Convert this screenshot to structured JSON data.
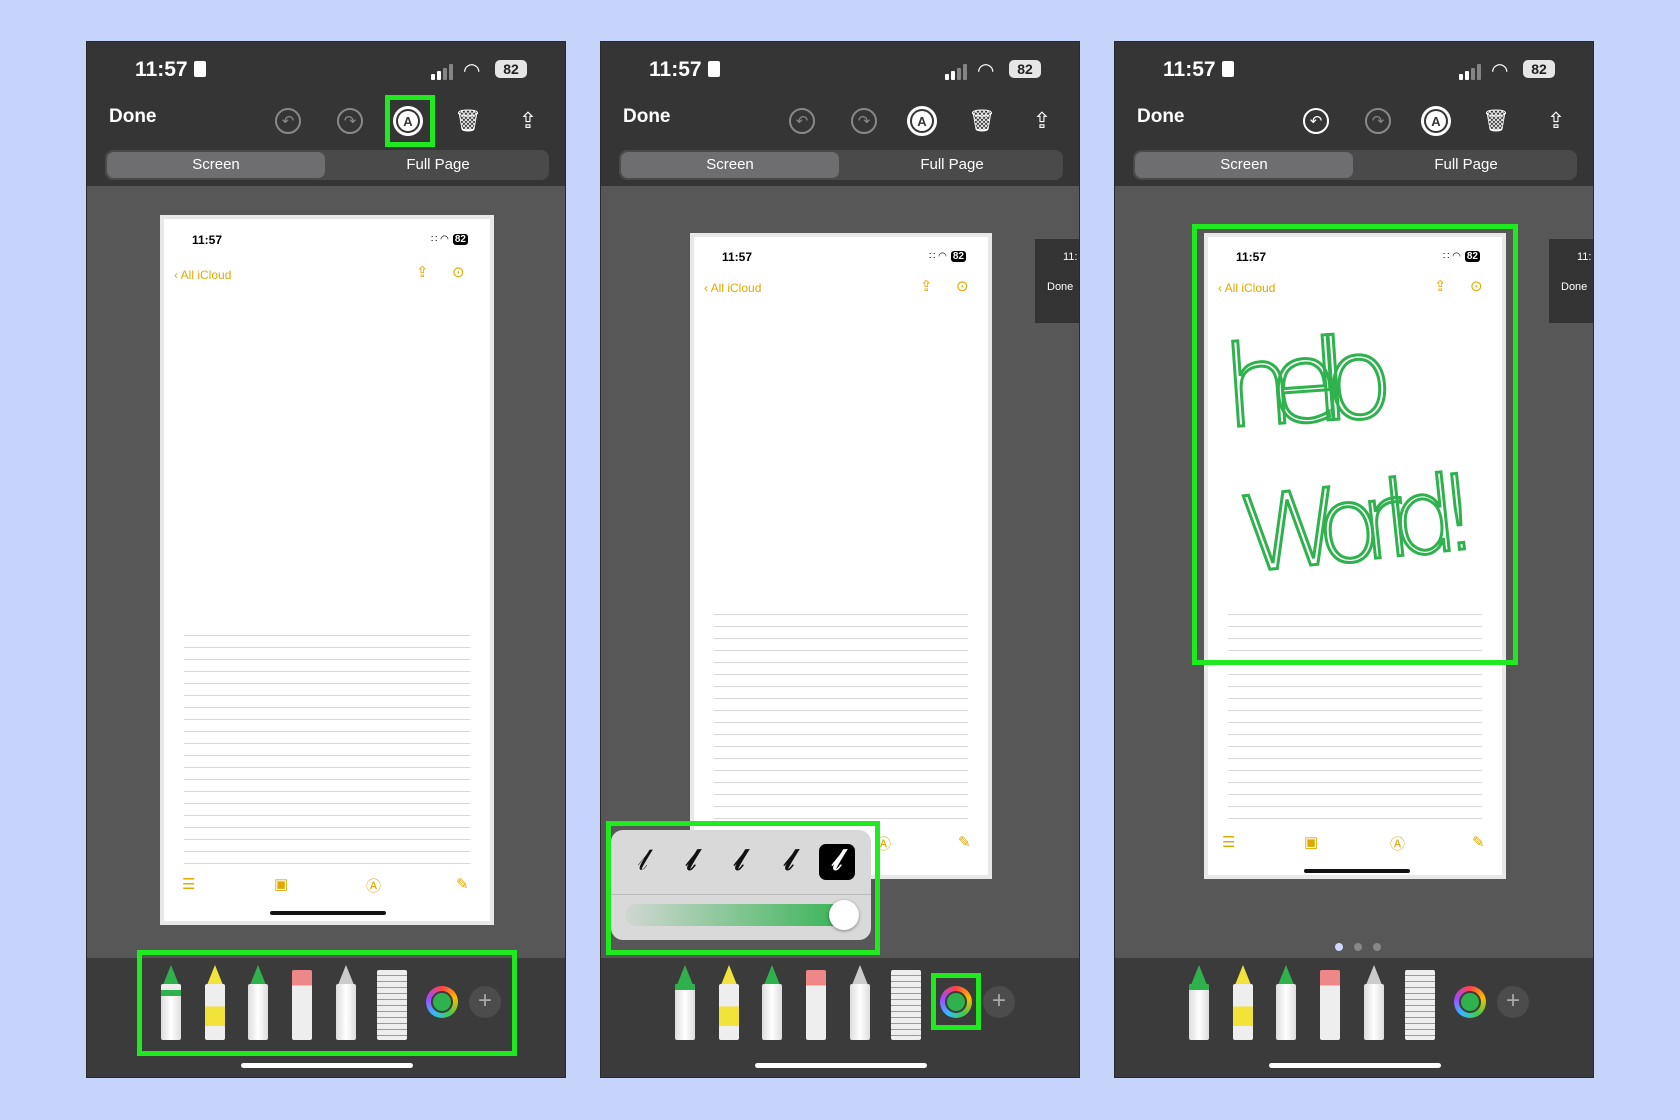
{
  "status": {
    "time": "11:57",
    "battery": "82"
  },
  "toolbar": {
    "done_label": "Done"
  },
  "tabs": {
    "screen": "Screen",
    "full_page": "Full Page"
  },
  "preview": {
    "time": "11:57",
    "battery": "82",
    "back_label": "All iCloud"
  },
  "side_thumb": {
    "time": "11:",
    "done": "Done"
  },
  "handwriting": {
    "line1": "hello",
    "line2": "World!"
  },
  "colors": {
    "highlight": "#1fea1f",
    "ink": "#2fb24e",
    "accent": "#e0a800"
  },
  "popup": {
    "opacity_percent": 100,
    "selected_stroke": 5
  },
  "page_dots": {
    "count": 3,
    "active": 1
  }
}
